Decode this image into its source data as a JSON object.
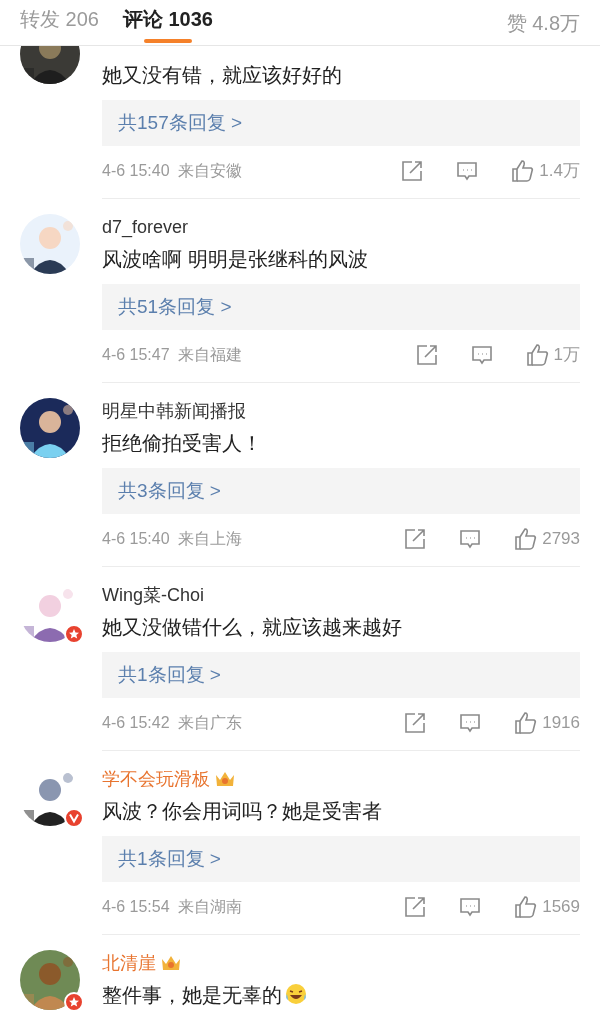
{
  "tabs": [
    {
      "label": "转发 206",
      "selected": false
    },
    {
      "label": "评论 1036",
      "selected": true
    }
  ],
  "likes_total": "赞 4.8万",
  "comments": [
    {
      "text": "她又没有错，就应该好好的",
      "replies": "共157条回复 >",
      "time": "4-6 15:40",
      "location": "来自安徽",
      "likes": "1.4万"
    },
    {
      "kind": "plain",
      "name": "d7_forever",
      "vip": false,
      "text": "风波啥啊 明明是张继科的风波",
      "replies": "共51条回复 >",
      "time": "4-6 15:47",
      "location": "来自福建",
      "likes": "1万"
    },
    {
      "kind": "plain",
      "name": "明星中韩新闻播报",
      "vip": false,
      "text": "拒绝偷拍受害人！",
      "replies": "共3条回复 >",
      "time": "4-6 15:40",
      "location": "来自上海",
      "likes": "2793"
    },
    {
      "kind": "starred",
      "name": "Wing菜-Choi",
      "vip": false,
      "text": "她又没做错什么，就应该越来越好",
      "replies": "共1条回复 >",
      "time": "4-6 15:42",
      "location": "来自广东",
      "likes": "1916"
    },
    {
      "kind": "verified",
      "name": "学不会玩滑板",
      "vip": true,
      "text": "风波？你会用词吗？她是受害者",
      "replies": "共1条回复 >",
      "time": "4-6 15:54",
      "location": "来自湖南",
      "likes": "1569"
    },
    {
      "kind": "starred",
      "name": "北清崖",
      "vip": true,
      "text": "整件事，她是无辜的",
      "emoji": true
    }
  ]
}
